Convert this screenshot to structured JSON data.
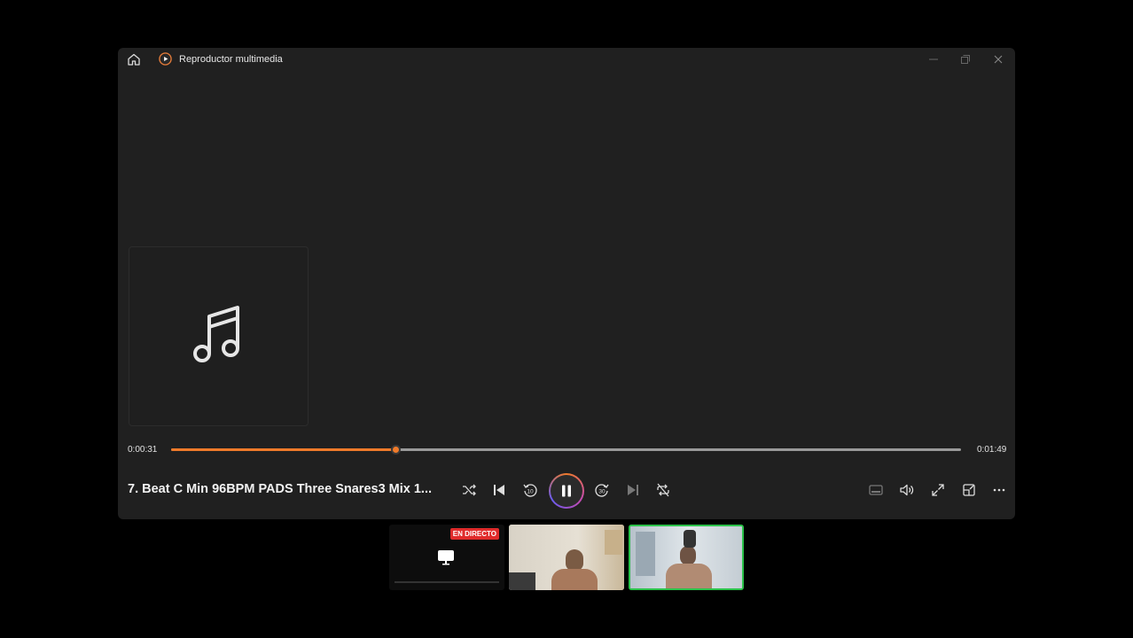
{
  "window": {
    "title": "Reproductor multimedia",
    "icons": [
      "home-icon",
      "media-player-app-icon",
      "minimize-icon",
      "maximize-icon",
      "close-icon"
    ]
  },
  "now_playing": {
    "song_title": "7. Beat C Min 96BPM PADS Three Snares3 Mix 1...",
    "current_time": "0:00:31",
    "total_time": "0:01:49",
    "progress_fraction": 0.284
  },
  "controls": {
    "left": [
      "shuffle-icon",
      "previous-icon",
      "rewind-10-icon",
      "pause-icon",
      "forward-30-icon",
      "next-icon",
      "repeat-off-icon"
    ],
    "right": [
      "mini-player-icon",
      "volume-icon",
      "fullscreen-icon",
      "cast-icon",
      "more-icon"
    ],
    "accent": "#f07a2a"
  },
  "video_call": {
    "live_badge": "EN DIRECTO",
    "participants": [
      "screen-share-tile",
      "participant-tile-1",
      "participant-tile-2"
    ],
    "active_speaker_color": "#2bc24a"
  }
}
